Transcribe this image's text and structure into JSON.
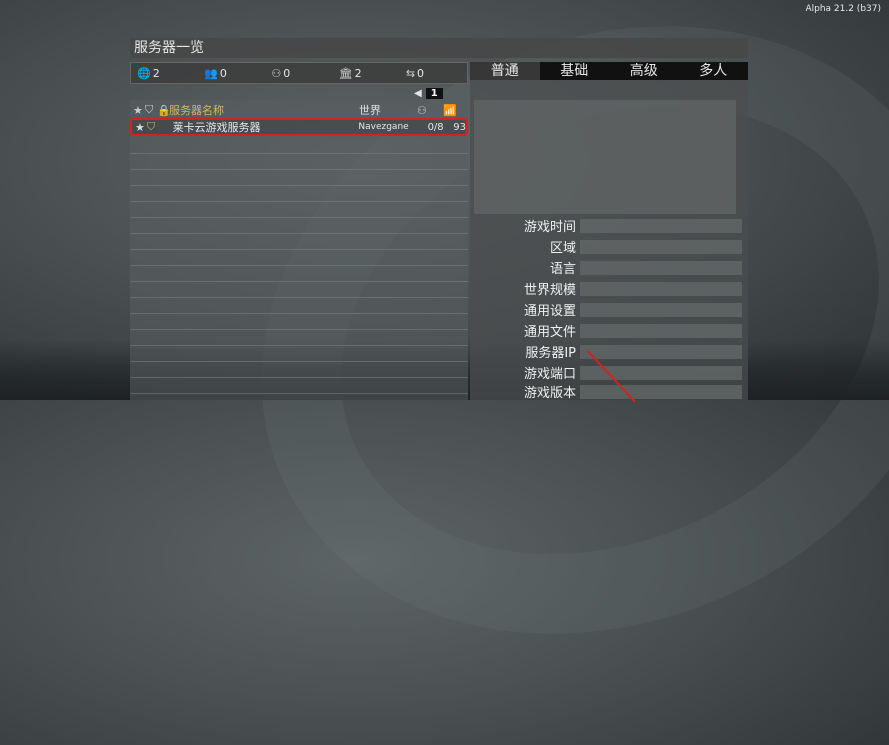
{
  "version": "Alpha 21.2 (b37)",
  "window_title": "服务器一览",
  "filters": [
    {
      "icon": "globe-icon",
      "glyph": "🌐",
      "count": "2"
    },
    {
      "icon": "players-icon",
      "glyph": "👥",
      "count": "0"
    },
    {
      "icon": "group-icon",
      "glyph": "⚇",
      "count": "0"
    },
    {
      "icon": "bank-icon",
      "glyph": "🏛",
      "count": "2"
    },
    {
      "icon": "transfer-icon",
      "glyph": "⇆",
      "count": "0"
    }
  ],
  "pager": {
    "page": "1"
  },
  "list": {
    "col_name": "服务器名称",
    "col_world": "世界",
    "rows": [
      {
        "name": "莱卡云游戏服务器",
        "world": "Navezgane",
        "players": "0/8",
        "ping": "93"
      }
    ]
  },
  "tabs": [
    "普通",
    "基础",
    "高级",
    "多人"
  ],
  "details": {
    "labels": [
      "游戏时间",
      "区域",
      "语言",
      "世界规模",
      "通用设置",
      "通用文件",
      "服务器IP",
      "游戏端口",
      "游戏版本"
    ]
  },
  "colors": {
    "accent": "#d6b56a",
    "highlight": "#d32222"
  }
}
